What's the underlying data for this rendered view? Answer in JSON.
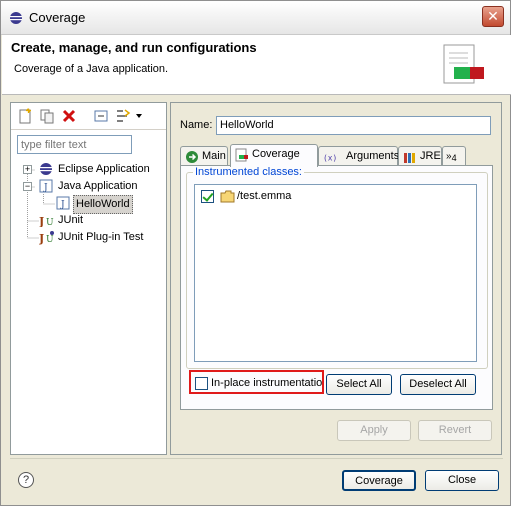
{
  "window": {
    "title": "Coverage"
  },
  "banner": {
    "title": "Create, manage, and run configurations",
    "subtitle": "Coverage of a Java application."
  },
  "left": {
    "filter_placeholder": "type filter text",
    "tree": [
      {
        "label": "Eclipse Application",
        "icon": "eclipse-icon"
      },
      {
        "label": "Java Application",
        "icon": "java-app-icon"
      },
      {
        "label": "HelloWorld",
        "icon": "java-app-icon",
        "selected": true
      },
      {
        "label": "JUnit",
        "icon": "junit-icon"
      },
      {
        "label": "JUnit Plug-in Test",
        "icon": "junit-plugin-icon"
      }
    ]
  },
  "config": {
    "name_label": "Name:",
    "name_value": "HelloWorld",
    "tabs": [
      {
        "label": "Main",
        "icon": "main-tab-icon"
      },
      {
        "label": "Coverage",
        "icon": "coverage-tab-icon",
        "active": true
      },
      {
        "label": "Arguments",
        "icon": "arguments-tab-icon"
      },
      {
        "label": "JRE",
        "icon": "jre-tab-icon"
      },
      {
        "label": "4",
        "icon": "more-tabs-icon"
      }
    ],
    "group_label": "Instrumented classes:",
    "classes": [
      {
        "label": "/test.emma",
        "checked": true
      }
    ],
    "inplace_label": "In-place instrumentatio",
    "inplace_checked": false,
    "select_all": "Select All",
    "deselect_all": "Deselect All",
    "apply": "Apply",
    "revert": "Revert"
  },
  "footer": {
    "coverage_btn": "Coverage",
    "close_btn": "Close"
  },
  "colors": {
    "highlight": "#e01a1a",
    "group_label": "#0046d5"
  }
}
